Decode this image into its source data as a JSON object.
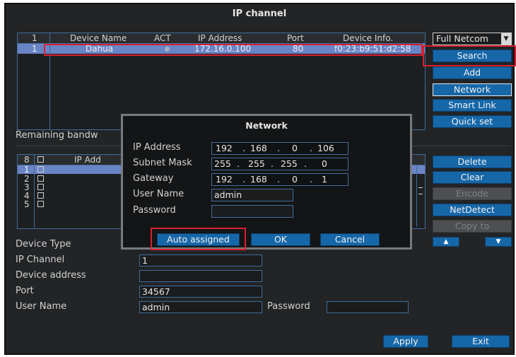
{
  "window": {
    "title": "IP channel"
  },
  "top_table": {
    "headers": {
      "index": "1",
      "name": "Device Name",
      "act": "ACT",
      "ip": "IP Address",
      "port": "Port",
      "info": "Device Info."
    },
    "row": {
      "index": "1",
      "name": "Dahua",
      "ip": "172.16.0.100",
      "port": "80",
      "info": "f0:23:b9:51:d2:58"
    }
  },
  "protocol_dropdown": {
    "value": "Full Netcom"
  },
  "right_buttons": {
    "search": "Search",
    "add": "Add",
    "network": "Network",
    "smart_link": "Smart Link",
    "quick_set": "Quick set"
  },
  "remaining_bandwidth_label": "Remaining bandw",
  "bottom_table": {
    "header_index": "8",
    "header_ip": "IP Add",
    "rows": [
      "1",
      "2",
      "3",
      "4",
      "5"
    ]
  },
  "right_buttons2": {
    "delete": "Delete",
    "clear": "Clear",
    "encode": "Encode",
    "net_detect": "NetDetect",
    "copy_to": "Copy to"
  },
  "device_form": {
    "device_type_label": "Device Type",
    "ip_channel_label": "IP Channel",
    "ip_channel_value": "1",
    "device_address_label": "Device address",
    "device_address_value": "",
    "port_label": "Port",
    "port_value": "34567",
    "user_name_label": "User Name",
    "user_name_value": "admin",
    "password_label": "Password",
    "password_value": ""
  },
  "bottom_buttons": {
    "apply": "Apply",
    "exit": "Exit"
  },
  "network_dialog": {
    "title": "Network",
    "ip_address_label": "IP Address",
    "ip_address": [
      "192",
      "168",
      "0",
      "106"
    ],
    "subnet_mask_label": "Subnet Mask",
    "subnet_mask": [
      "255",
      "255",
      "255",
      "0"
    ],
    "gateway_label": "Gateway",
    "gateway": [
      "192",
      "168",
      "0",
      "1"
    ],
    "user_name_label": "User Name",
    "user_name_value": "admin",
    "password_label": "Password",
    "password_value": "",
    "auto_assigned": "Auto assigned",
    "ok": "OK",
    "cancel": "Cancel"
  },
  "colors": {
    "accent_blue": "#1667a8",
    "selection": "#6a85c6",
    "highlight_red": "#d62030"
  }
}
